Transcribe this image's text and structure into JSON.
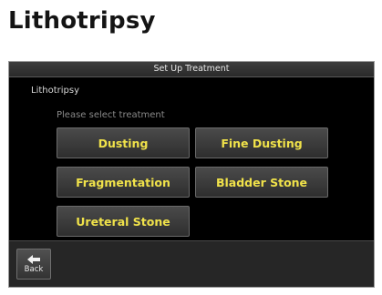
{
  "page": {
    "title": "Lithotripsy"
  },
  "screen": {
    "header_title": "Set Up Treatment",
    "section_label": "Lithotripsy",
    "hint": "Please select treatment",
    "treatments": [
      {
        "label": "Dusting"
      },
      {
        "label": "Fine Dusting"
      },
      {
        "label": "Fragmentation"
      },
      {
        "label": "Bladder Stone"
      },
      {
        "label": "Ureteral Stone"
      }
    ],
    "back_label": "Back"
  },
  "colors": {
    "button_text": "#f0e24a",
    "screen_bg": "#000000"
  }
}
